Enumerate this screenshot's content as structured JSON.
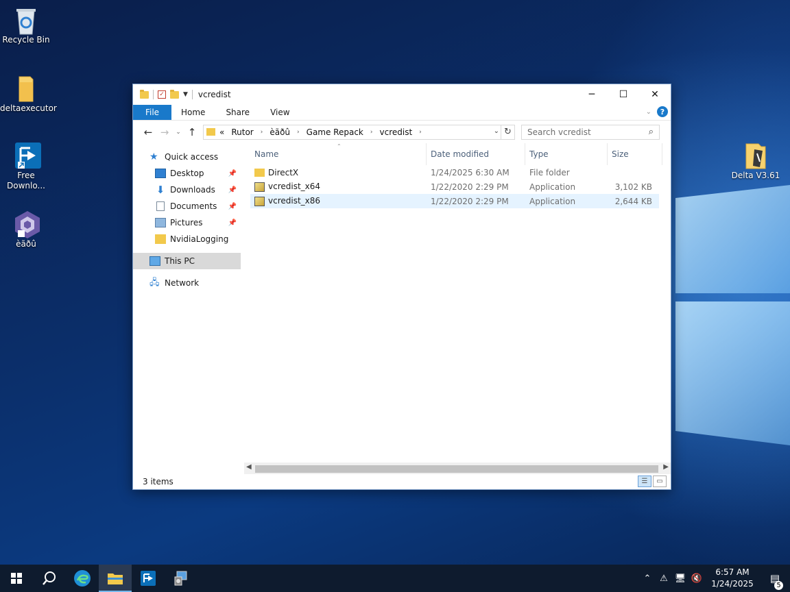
{
  "desktop": {
    "icons_left": [
      {
        "label": "Recycle Bin",
        "icon": "recycle-bin-icon"
      },
      {
        "label": "deltaexecutor",
        "icon": "folder-icon"
      },
      {
        "label": "Free Downlo...",
        "label_line1": "Free",
        "label_line2": "Downlo...",
        "icon": "free-download-manager-icon"
      },
      {
        "label": "èãðû",
        "icon": "gamecube-icon"
      }
    ],
    "icon_right": {
      "label": "Delta V3.61",
      "icon": "archive-folder-icon"
    }
  },
  "window": {
    "title": "vcredist",
    "controls": {
      "minimize": "─",
      "maximize": "☐",
      "close": "✕"
    },
    "ribbon_tabs": [
      "File",
      "Home",
      "Share",
      "View"
    ],
    "breadcrumbs": [
      "«",
      "Rutor",
      "èãðû",
      "Game Repack",
      "vcredist"
    ],
    "search_placeholder": "Search vcredist",
    "nav_pane": [
      {
        "label": "Quick access",
        "icon": "star-icon",
        "pinned": false,
        "level": 0
      },
      {
        "label": "Desktop",
        "icon": "desktop-icon",
        "pinned": true,
        "level": 1
      },
      {
        "label": "Downloads",
        "icon": "download-icon",
        "pinned": true,
        "level": 1
      },
      {
        "label": "Documents",
        "icon": "documents-icon",
        "pinned": true,
        "level": 1
      },
      {
        "label": "Pictures",
        "icon": "pictures-icon",
        "pinned": true,
        "level": 1
      },
      {
        "label": "NvidiaLogging",
        "icon": "folder-icon",
        "pinned": false,
        "level": 1
      },
      {
        "label": "This PC",
        "icon": "pc-icon",
        "pinned": false,
        "level": 0,
        "selected": true
      },
      {
        "label": "Network",
        "icon": "network-icon",
        "pinned": false,
        "level": 0
      }
    ],
    "columns": [
      "Name",
      "Date modified",
      "Type",
      "Size"
    ],
    "files": [
      {
        "name": "DirectX",
        "date": "1/24/2025 6:30 AM",
        "type": "File folder",
        "size": "",
        "icon": "folder-icon"
      },
      {
        "name": "vcredist_x64",
        "date": "1/22/2020 2:29 PM",
        "type": "Application",
        "size": "3,102 KB",
        "icon": "installer-icon"
      },
      {
        "name": "vcredist_x86",
        "date": "1/22/2020 2:29 PM",
        "type": "Application",
        "size": "2,644 KB",
        "icon": "installer-icon",
        "selected": true
      }
    ],
    "status": "3 items"
  },
  "taskbar": {
    "time": "6:57 AM",
    "date": "1/24/2025",
    "notification_count": "5",
    "colors": {
      "background": "#0e1b2e",
      "accent": "#76b9ed"
    }
  }
}
